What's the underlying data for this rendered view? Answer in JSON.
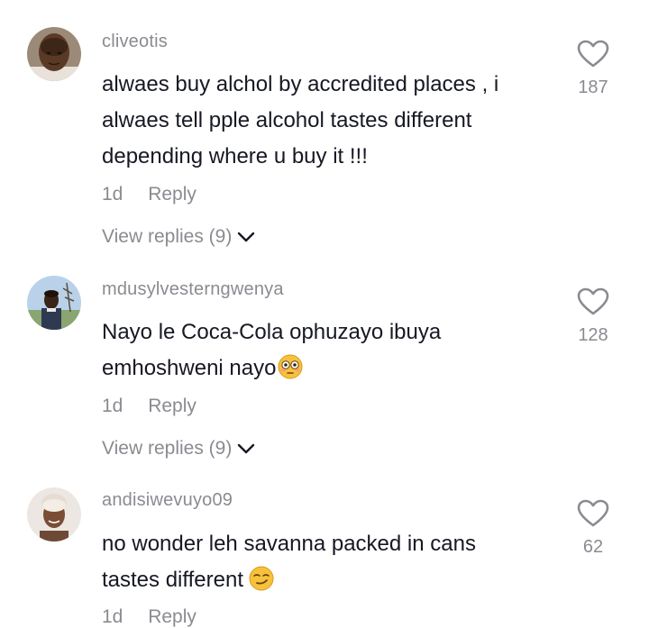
{
  "comments": [
    {
      "username": "cliveotis",
      "text": "alwaes buy alchol by accredited places , i alwaes tell pple alcohol tastes different depending where u buy it !!!",
      "time": "1d",
      "reply_label": "Reply",
      "view_replies": "View replies (9)",
      "likes": "187"
    },
    {
      "username": "mdusylvesterngwenya",
      "text": "Nayo le Coca-Cola ophuzayo ibuya emhoshweni nayo",
      "emoji": "flushed-face-emoji",
      "time": "1d",
      "reply_label": "Reply",
      "view_replies": "View replies (9)",
      "likes": "128"
    },
    {
      "username": "andisiwevuyo09",
      "text": "no wonder leh savanna packed in cans tastes different",
      "emoji": "smirking-face-emoji",
      "time": "1d",
      "reply_label": "Reply",
      "likes": "62"
    }
  ],
  "colors": {
    "text": "#161823",
    "muted": "#8a8b91",
    "emoji_yellow": "#f7c23b"
  }
}
